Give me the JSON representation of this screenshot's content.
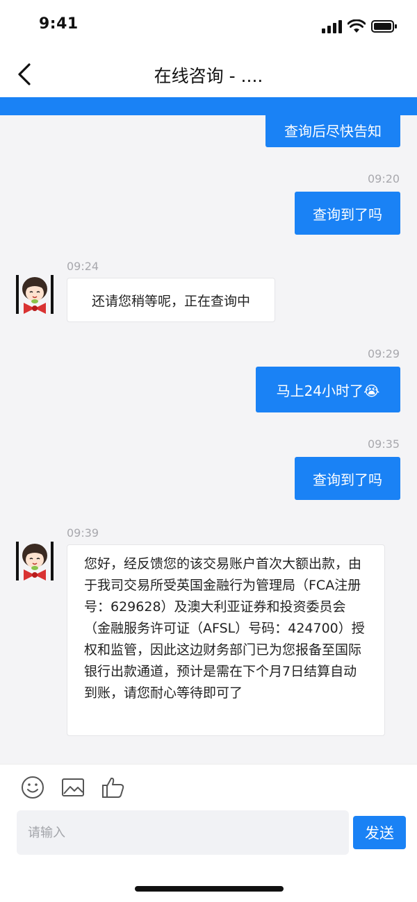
{
  "status": {
    "time": "9:41"
  },
  "header": {
    "title": "在线咨询 - ...."
  },
  "messages": [
    {
      "dir": "out",
      "text": "查询后尽快告知"
    },
    {
      "time": "09:20",
      "dir": "out",
      "text": "查询到了吗"
    },
    {
      "time": "09:24",
      "dir": "in",
      "text": "还请您稍等呢，正在查询中"
    },
    {
      "time": "09:29",
      "dir": "out",
      "text": "马上24小时了😭"
    },
    {
      "time": "09:35",
      "dir": "out",
      "text": "查询到了吗"
    },
    {
      "time": "09:39",
      "dir": "in",
      "text": "您好，经反馈您的该交易账户首次大额出款，由于我司交易所受英国金融行为管理局（FCA注册号：629628）及澳大利亚证券和投资委员会（金融服务许可证（AFSL）号码：424700）授权和监管，因此这边财务部门已为您报备至国际银行出款通道，预计是需在下个月7日结算自动到账，请您耐心等待即可了"
    }
  ],
  "composer": {
    "placeholder": "请输入",
    "value": "",
    "send_label": "发送"
  },
  "colors": {
    "accent": "#1a82f5",
    "chat_bg": "#f4f4f6",
    "timestamp": "#a8a8ad"
  }
}
